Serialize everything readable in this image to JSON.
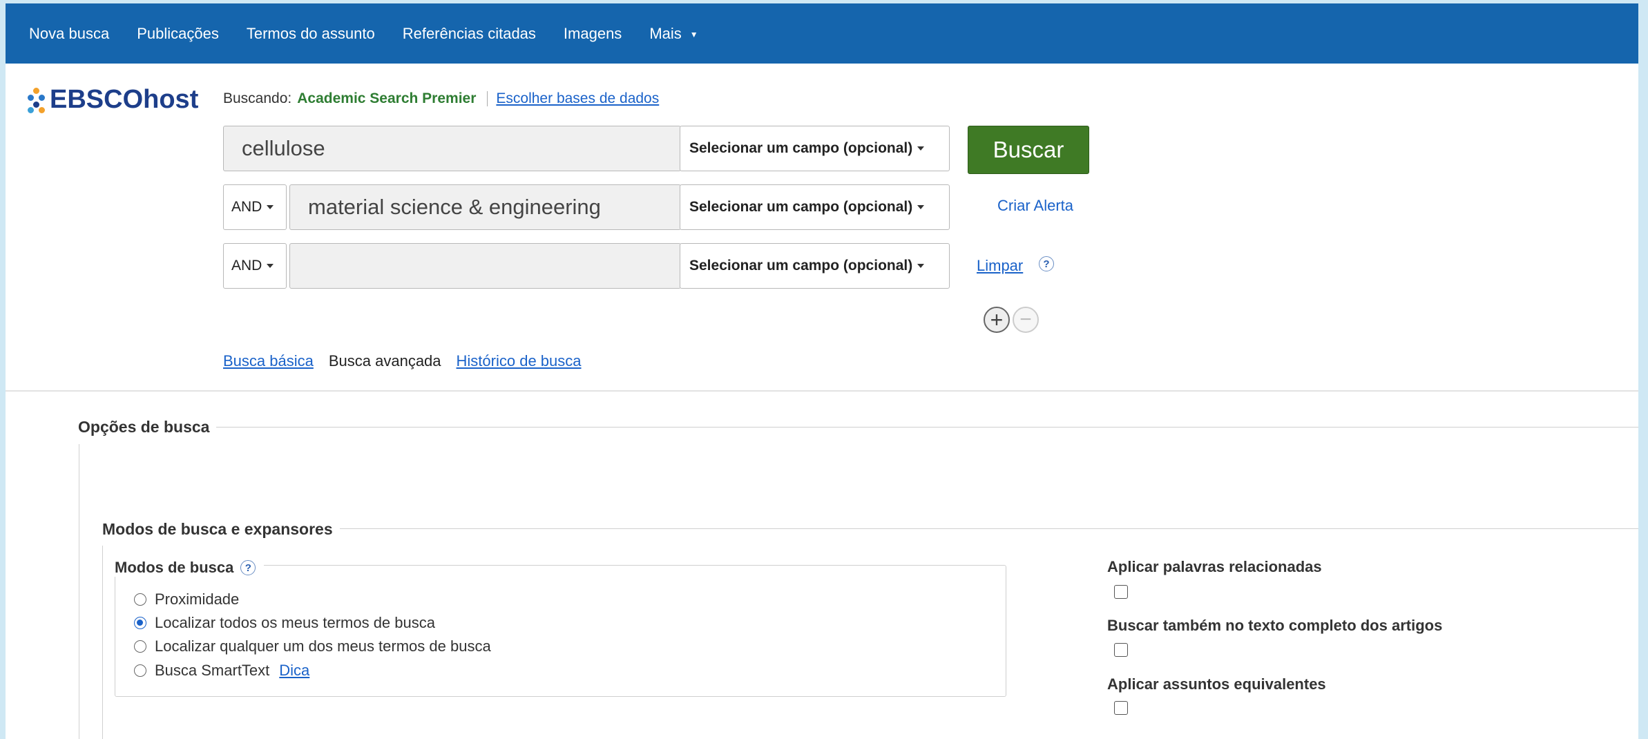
{
  "nav": {
    "items": [
      "Nova busca",
      "Publicações",
      "Termos do assunto",
      "Referências citadas",
      "Imagens",
      "Mais"
    ]
  },
  "logo": {
    "text": "EBSCOhost"
  },
  "searching": {
    "label": "Buscando:",
    "database": "Academic Search Premier",
    "choose_db": "Escolher bases de dados"
  },
  "search": {
    "rows": [
      {
        "operator": "",
        "value": "cellulose",
        "field": "Selecionar um campo (opcional)"
      },
      {
        "operator": "AND",
        "value": "material science & engineering",
        "field": "Selecionar um campo (opcional)"
      },
      {
        "operator": "AND",
        "value": "",
        "field": "Selecionar um campo (opcional)"
      }
    ],
    "search_button": "Buscar",
    "create_alert": "Criar Alerta",
    "clear": "Limpar",
    "help_glyph": "?",
    "add_glyph": "+",
    "remove_glyph": "−"
  },
  "search_links": {
    "basic": "Busca básica",
    "advanced": "Busca avançada",
    "history": "Histórico de busca"
  },
  "options": {
    "title": "Opções de busca",
    "modes_expanders_title": "Modos de busca e expansores",
    "modes_title": "Modos de busca",
    "modes": [
      {
        "label": "Proximidade",
        "checked": false
      },
      {
        "label": "Localizar todos os meus termos de busca",
        "checked": true
      },
      {
        "label": "Localizar qualquer um dos meus termos de busca",
        "checked": false
      },
      {
        "label": "Busca SmartText",
        "checked": false,
        "link": "Dica"
      }
    ],
    "expanders": [
      {
        "label": "Aplicar palavras relacionadas",
        "checked": false
      },
      {
        "label": "Buscar também no texto completo dos artigos",
        "checked": false
      },
      {
        "label": "Aplicar assuntos equivalentes",
        "checked": false
      }
    ]
  },
  "colors": {
    "nav_bg": "#1565ad",
    "search_button_bg": "#3f7a25",
    "database_text": "#2e7d32",
    "link": "#1a62c9"
  }
}
